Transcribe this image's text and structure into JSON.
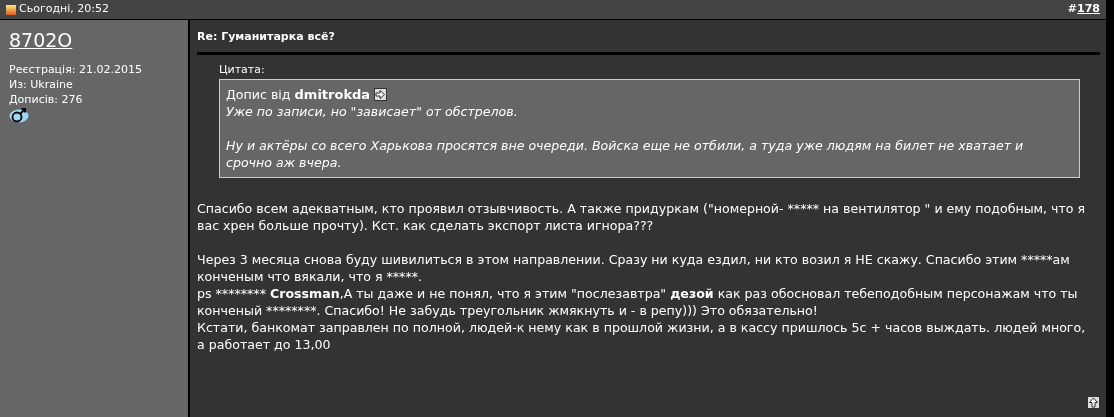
{
  "post_header": {
    "date": "Сьогодні, 20:52",
    "post_number_prefix": "#",
    "post_number": "178"
  },
  "user": {
    "name": "8702O",
    "details": [
      "Реєстрація: 21.02.2015",
      "Из: Ukraine",
      "Дописів: 276"
    ]
  },
  "post": {
    "title": "Re: Гуманитарка всё?",
    "quote": {
      "label": "Цитата:",
      "author_prefix": "Допис від",
      "author": "dmitrokda",
      "paragraphs": [
        "Уже по записи, но \"зависает\" от обстрелов.",
        "Ну и актёры со всего Харькова просятся вне очереди. Войска еще не отбили, а туда уже людям на билет не хватает и срочно аж вчера."
      ]
    },
    "paragraphs": [
      [
        {
          "lines": [
            [
              {
                "text": "Спасибо всем адекватным, кто проявил отзывчивость. А также придуркам (\"номерной- ***** на вентилятор \" и ему подобным, что я вас хрен больше прочту). Кст. как сделать экспорт листа игнора???",
                "bold": false
              }
            ]
          ]
        }
      ],
      [
        {
          "lines": [
            [
              {
                "text": "Через 3 месяца снова буду шивилиться в этом направлении. Сразу ни куда ездил, ни кто возил я НЕ скажу. Спасибо этим *****ам конченым что вякали, что я *****.",
                "bold": false
              }
            ],
            [
              {
                "text": "ps ******** ",
                "bold": false
              },
              {
                "text": "Crossman",
                "bold": true
              },
              {
                "text": ",А ты даже и не понял, что я этим \"послезавтра\" ",
                "bold": false
              },
              {
                "text": "дезой",
                "bold": true
              },
              {
                "text": " как раз обосновал тебеподобным персонажам что ты конченый ********. Спасибо! Не забудь треугольник жмякнуть и - в репу))) Это обязательно!",
                "bold": false
              }
            ],
            [
              {
                "text": "Кстати, банкомат заправлен по полной, людей-к нему как в прошлой жизни, а в кассу пришлось 5с + часов выждать. людей много, а работает до 13,00",
                "bold": false
              }
            ]
          ]
        }
      ]
    ]
  }
}
